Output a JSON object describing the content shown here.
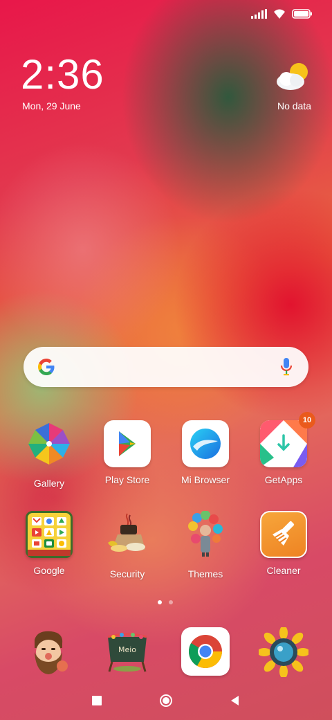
{
  "status_bar": {
    "signal_icon": "cellular-signal-icon",
    "wifi_icon": "wifi-icon",
    "battery_icon": "battery-icon"
  },
  "clock": {
    "time": "2:36",
    "date": "Mon, 29 June"
  },
  "weather": {
    "icon": "partly-cloudy-icon",
    "text": "No data"
  },
  "search": {
    "logo": "google-g-icon",
    "mic": "microphone-icon"
  },
  "apps": [
    {
      "label": "Gallery",
      "icon": "pinwheel-icon"
    },
    {
      "label": "Play Store",
      "icon": "play-store-icon"
    },
    {
      "label": "Mi Browser",
      "icon": "mi-browser-icon"
    },
    {
      "label": "GetApps",
      "icon": "getapps-icon",
      "badge": "10"
    },
    {
      "label": "Google",
      "icon": "google-folder-icon"
    },
    {
      "label": "Security",
      "icon": "security-icon"
    },
    {
      "label": "Themes",
      "icon": "themes-balloons-icon"
    },
    {
      "label": "Cleaner",
      "icon": "cleaner-brush-icon"
    }
  ],
  "pager": {
    "pages": 2,
    "current": 1
  },
  "dock": [
    {
      "name": "phone-app",
      "icon": "bearded-man-icon"
    },
    {
      "name": "messages-app",
      "icon": "chalkboard-icon",
      "text": "Meio"
    },
    {
      "name": "chrome-app",
      "icon": "chrome-icon"
    },
    {
      "name": "camera-app",
      "icon": "sunflower-camera-icon"
    }
  ],
  "nav": {
    "recents": "recents-square-icon",
    "home": "home-circle-icon",
    "back": "back-triangle-icon"
  },
  "colors": {
    "badge": "#ea5a1c",
    "getapps_badge_text": "#ffffff"
  }
}
